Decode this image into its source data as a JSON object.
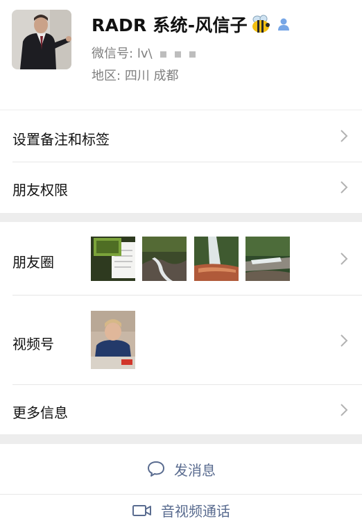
{
  "profile": {
    "name": "RADR 系统-风信子",
    "wechat_id_label": "微信号:",
    "wechat_id_value": "lv\\",
    "region_label": "地区:",
    "region_value": "四川  成都",
    "avatar_icon": "person-photo-avatar",
    "emoji_icon": "bee-icon",
    "gender_icon": "male-user-icon"
  },
  "menu": {
    "remark_label": "设置备注和标签",
    "permissions_label": "朋友权限",
    "moments_label": "朋友圈",
    "channels_label": "视频号",
    "more_info_label": "更多信息"
  },
  "actions": {
    "message_label": "发消息",
    "call_label": "音视频通话"
  },
  "colors": {
    "page_bg": "#ededed",
    "card_bg": "#ffffff",
    "link_blue": "#596b8f",
    "secondary_text": "#7f7f7f",
    "gender_blue": "#76a6e6"
  }
}
